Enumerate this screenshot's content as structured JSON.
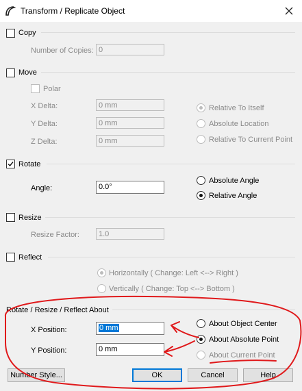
{
  "window": {
    "title": "Transform / Replicate Object"
  },
  "copy": {
    "label": "Copy",
    "checked": false,
    "copies_label": "Number of Copies:",
    "copies_value": "0"
  },
  "move": {
    "label": "Move",
    "checked": false,
    "polar_label": "Polar",
    "x_label": "X Delta:",
    "x_value": "0 mm",
    "y_label": "Y Delta:",
    "y_value": "0 mm",
    "z_label": "Z Delta:",
    "z_value": "0 mm",
    "options": [
      "Relative To Itself",
      "Absolute Location",
      "Relative To Current Point"
    ]
  },
  "rotate": {
    "label": "Rotate",
    "checked": true,
    "angle_label": "Angle:",
    "angle_value": "0.0°",
    "options": [
      "Absolute Angle",
      "Relative Angle"
    ]
  },
  "resize": {
    "label": "Resize",
    "checked": false,
    "factor_label": "Resize Factor:",
    "factor_value": "1.0"
  },
  "reflect": {
    "label": "Reflect",
    "checked": false,
    "options": [
      "Horizontally ( Change: Left <--> Right )",
      "Vertically ( Change: Top <--> Bottom )"
    ]
  },
  "about": {
    "label": "Rotate / Resize / Reflect About",
    "x_label": "X Position:",
    "x_value": "0 mm",
    "y_label": "Y Position:",
    "y_value": "0 mm",
    "options": [
      "About Object Center",
      "About Absolute Point",
      "About Current Point"
    ]
  },
  "buttons": {
    "number_style": "Number Style...",
    "ok": "OK",
    "cancel": "Cancel",
    "help": "Help"
  },
  "colors": {
    "annotation": "#e0191b",
    "accent": "#0078d7"
  }
}
